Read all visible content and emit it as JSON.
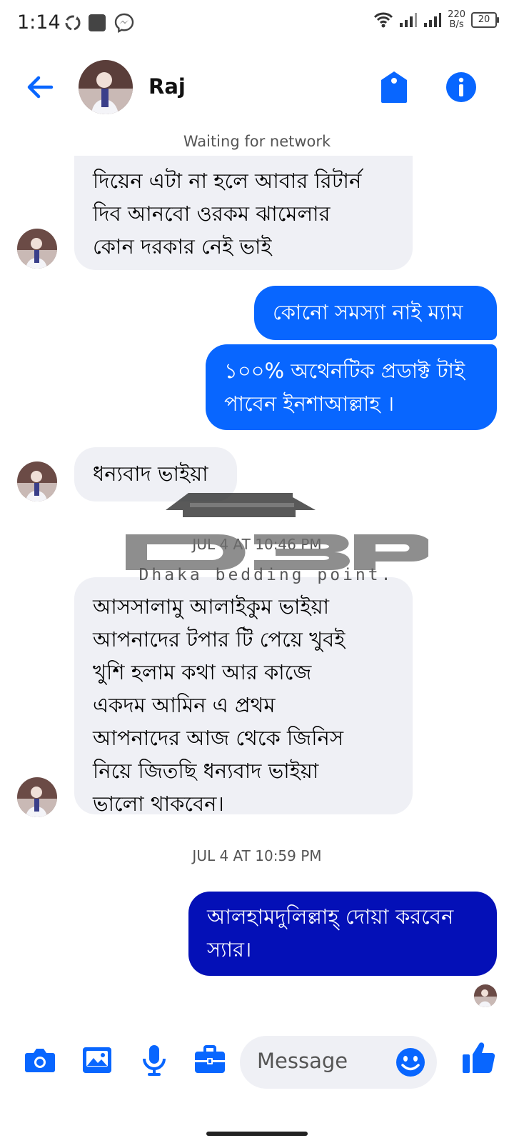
{
  "status_bar": {
    "time": "1:14",
    "net_speed_value": "220",
    "net_speed_unit": "B/s",
    "battery": "20"
  },
  "header": {
    "contact_name": "Raj",
    "icons": [
      "back-arrow-icon",
      "tag-icon",
      "info-icon"
    ]
  },
  "banner": "Waiting for network",
  "messages": [
    {
      "from": "contact",
      "lines": [
        "দিয়েন এটা না হলে আবার রিটার্ন",
        "দিব আনবো ওরকম ঝামেলার",
        "কোন দরকার নেই ভাই"
      ]
    },
    {
      "from": "me",
      "lines": [
        "কোনো সমস্যা নাই ম্যাম"
      ]
    },
    {
      "from": "me",
      "lines": [
        "১০০% অথেনটিক প্রডাক্ট টাই",
        "পাবেন ইনশাআল্লাহ ।"
      ]
    },
    {
      "from": "contact",
      "lines": [
        "ধন্যবাদ ভাইয়া"
      ]
    },
    {
      "from": "contact",
      "lines": [
        "আসসালামু আলাইকুম ভাইয়া",
        "আপনাদের টপার টি পেয়ে খুবই",
        "খুশি হলাম কথা আর কাজে",
        "একদম আমিন এ প্রথম",
        "আপনাদের আজ থেকে জিনিস",
        "নিয়ে জিতছি ধন্যবাদ ভাইয়া",
        "ভালো থাকবেন।"
      ]
    },
    {
      "from": "me",
      "lines": [
        "আলহামদুলিল্লাহ্‌ দোয়া করবেন",
        "স্যার।"
      ]
    }
  ],
  "timestamps": [
    "JUL 4 AT 10:46 PM",
    "JUL 4 AT 10:59 PM"
  ],
  "watermark": {
    "logo_text": "DBP",
    "tagline": "Dhaka bedding point."
  },
  "composer": {
    "placeholder": "Message",
    "icons": [
      "camera-icon",
      "image-icon",
      "microphone-icon",
      "briefcase-icon",
      "emoji-icon",
      "thumbs-up-icon"
    ]
  },
  "colors": {
    "accent": "#0866ff",
    "outgoing_latest": "#0410b7",
    "incoming": "#eff0f5"
  }
}
